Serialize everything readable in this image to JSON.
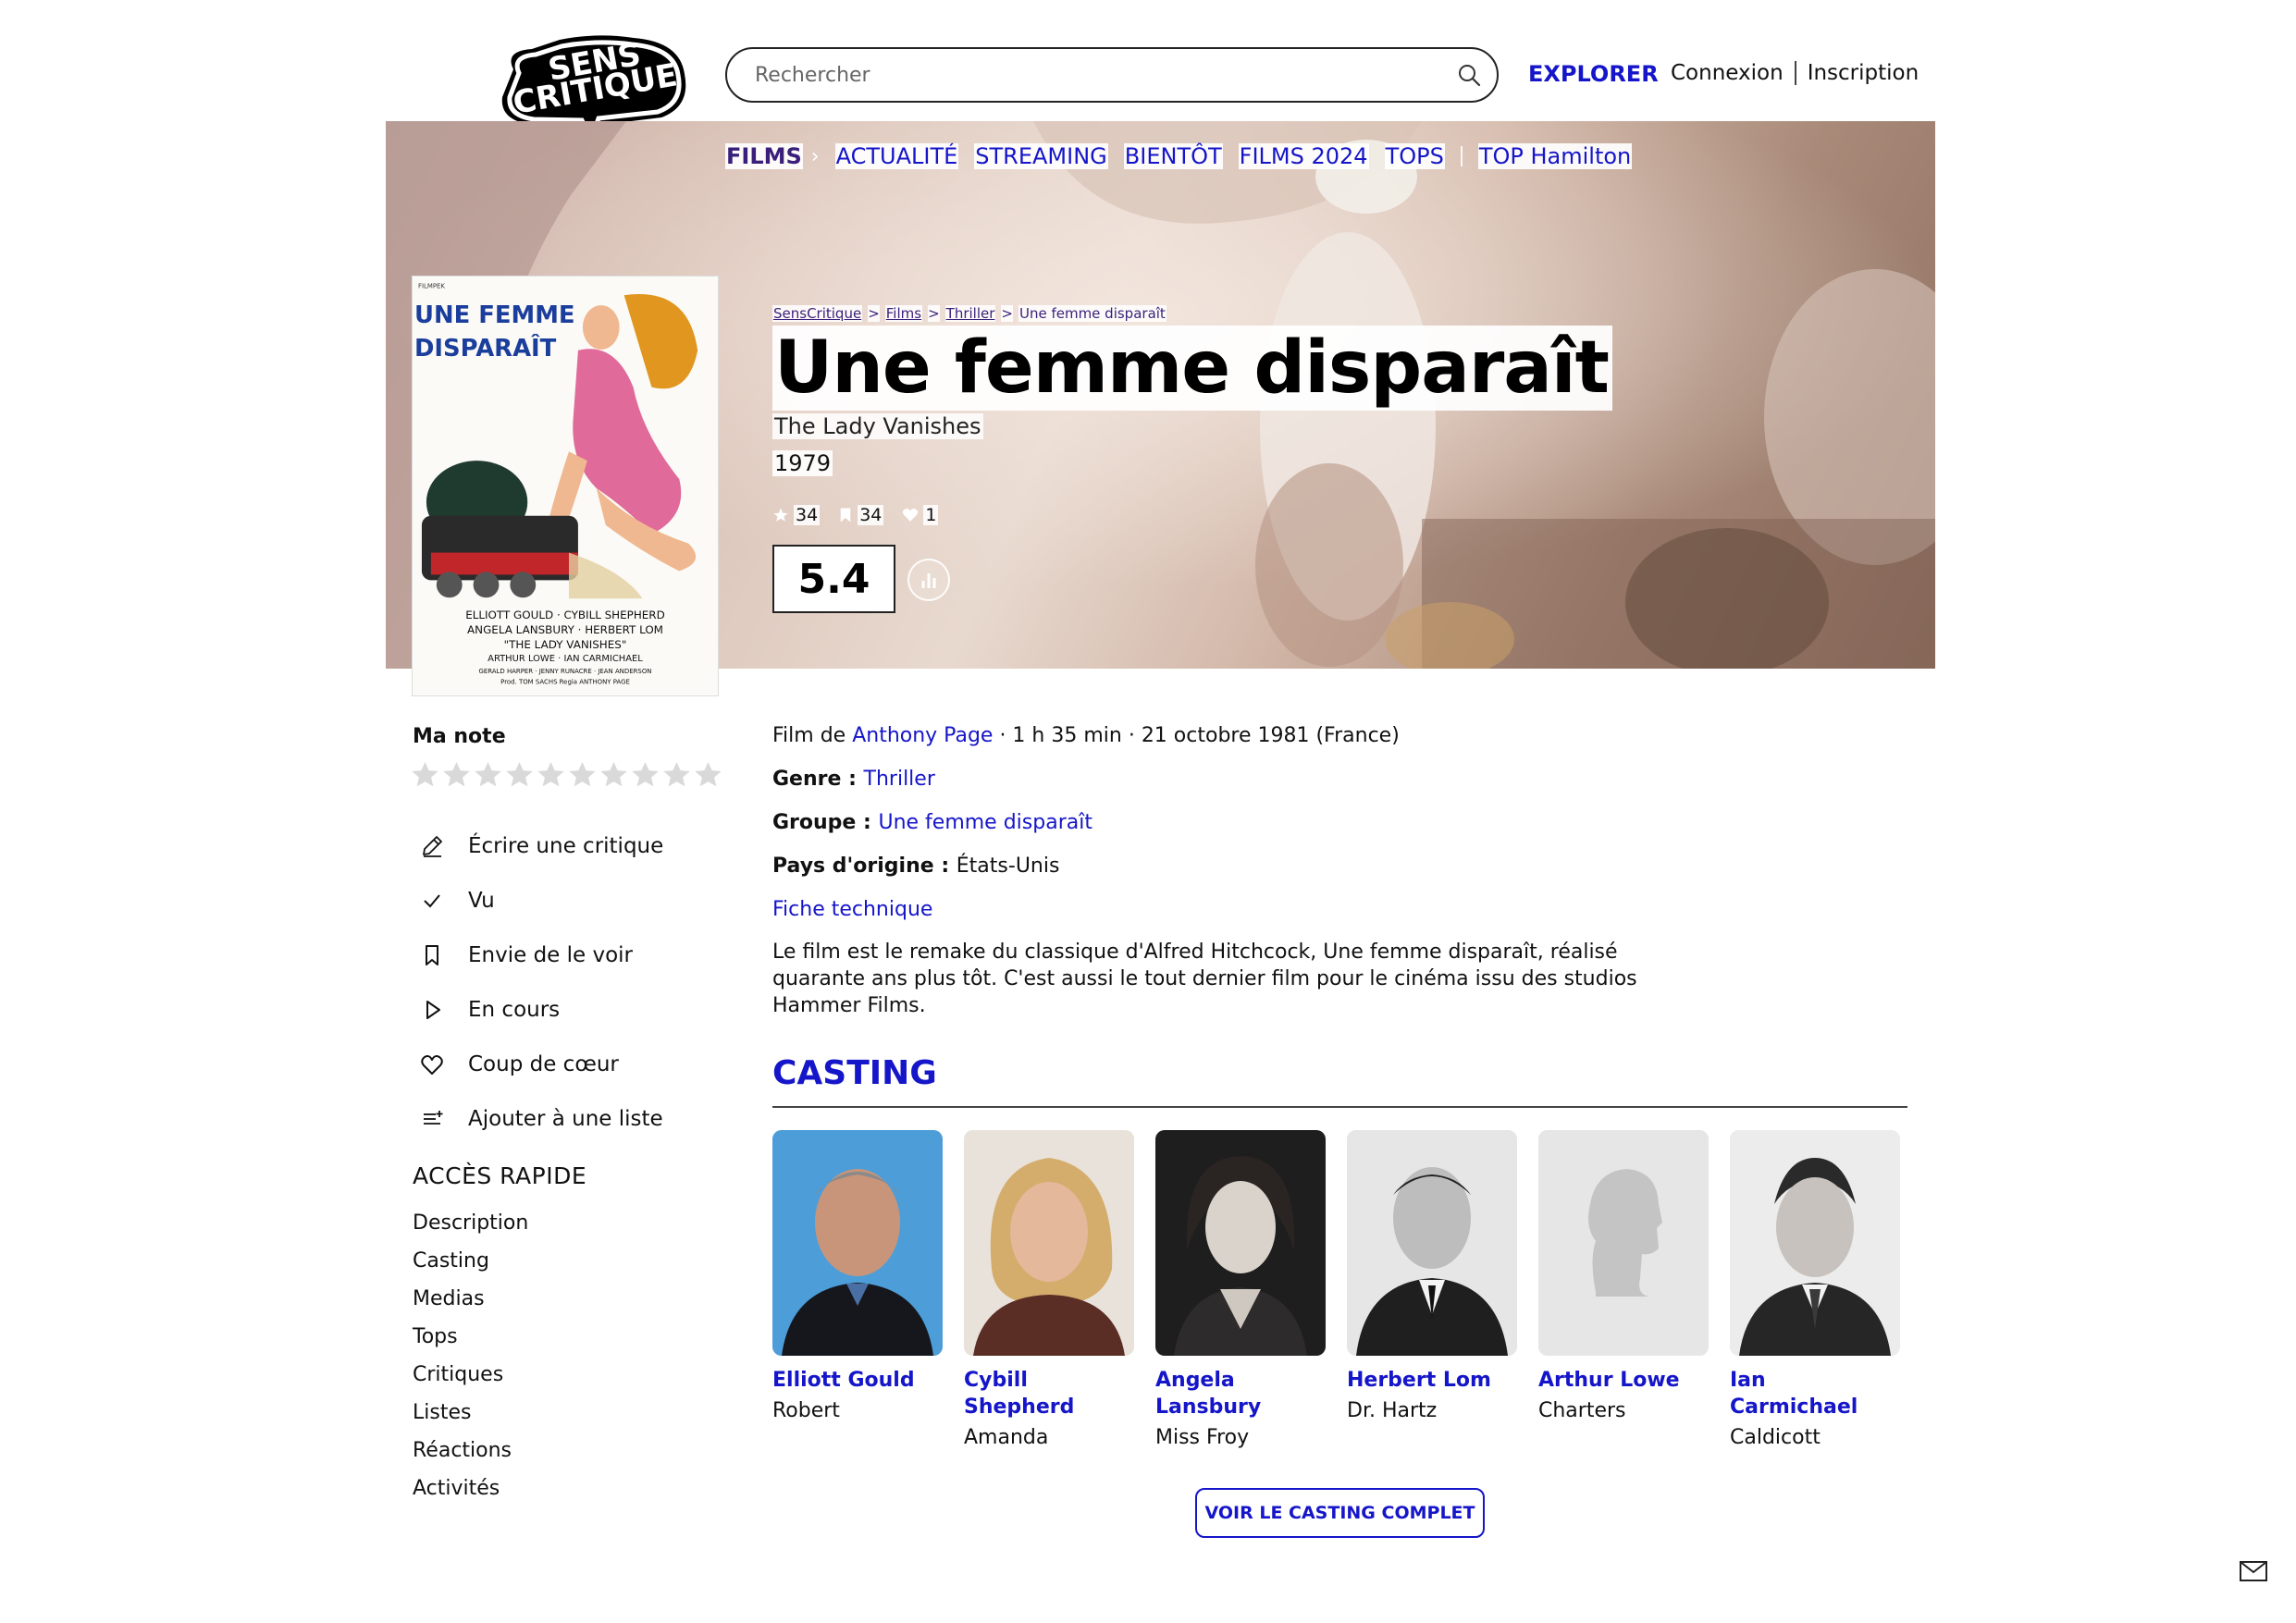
{
  "header": {
    "logo_text": [
      "SENS",
      "CRITIQUE"
    ],
    "search_placeholder": "Rechercher",
    "explorer": "EXPLORER",
    "login": "Connexion",
    "signup": "Inscription"
  },
  "subnav": {
    "items": [
      "FILMS",
      "ACTUALITÉ",
      "STREAMING",
      "BIENTÔT",
      "FILMS 2024",
      "TOPS",
      "TOP Hamilton"
    ],
    "current": "FILMS"
  },
  "breadcrumb": [
    "SensCritique",
    "Films",
    "Thriller",
    "Une femme disparaît"
  ],
  "film": {
    "title": "Une femme disparaît",
    "original_title": "The Lady Vanishes",
    "year": "1979",
    "stats": {
      "ratings": "34",
      "wishlist": "34",
      "favorites": "1"
    },
    "score": "5.4",
    "poster": {
      "title_lines": [
        "UNE FEMME",
        "DISPARAÎT"
      ],
      "credits": [
        "ELLIOTT GOULD · CYBILL SHEPHERD",
        "ANGELA LANSBURY · HERBERT LOM",
        "\"THE LADY VANISHES\"",
        "ARTHUR LOWE · IAN CARMICHAEL",
        "GERALD HARPER · JENNY RUNACRE · JEAN ANDERSON",
        "Prod. TOM SACHS    Regia ANTHONY PAGE"
      ],
      "brand": "FILMPEK"
    }
  },
  "sidebar": {
    "ma_note": "Ma note",
    "star_count": 10,
    "actions": [
      {
        "label": "Écrire une critique",
        "icon": "pencil-icon"
      },
      {
        "label": "Vu",
        "icon": "check-icon"
      },
      {
        "label": "Envie de le voir",
        "icon": "bookmark-icon"
      },
      {
        "label": "En cours",
        "icon": "play-icon"
      },
      {
        "label": "Coup de cœur",
        "icon": "heart-icon"
      },
      {
        "label": "Ajouter à une liste",
        "icon": "list-add-icon"
      }
    ],
    "quick_access_title": "ACCÈS RAPIDE",
    "quick_access": [
      "Description",
      "Casting",
      "Medias",
      "Tops",
      "Critiques",
      "Listes",
      "Réactions",
      "Activités"
    ]
  },
  "info": {
    "film_de": "Film de ",
    "director": "Anthony Page",
    "details": " · 1 h 35 min · 21 octobre 1981 (France)",
    "genre_label": "Genre : ",
    "genre": "Thriller",
    "groupe_label": "Groupe : ",
    "groupe": "Une femme disparaît",
    "pays_label": "Pays d'origine : ",
    "pays": "États-Unis",
    "fiche": "Fiche technique",
    "description": "Le film est le remake du classique d'Alfred Hitchcock, Une femme disparaît, réalisé quarante ans plus tôt. C'est aussi le tout dernier film pour le cinéma issu des studios Hammer Films."
  },
  "casting": {
    "title": "CASTING",
    "members": [
      {
        "name": "Elliott Gould",
        "role": "Robert"
      },
      {
        "name": "Cybill Shepherd",
        "role": "Amanda"
      },
      {
        "name": "Angela Lansbury",
        "role": "Miss Froy"
      },
      {
        "name": "Herbert Lom",
        "role": "Dr. Hartz"
      },
      {
        "name": "Arthur Lowe",
        "role": "Charters"
      },
      {
        "name": "Ian Carmichael",
        "role": "Caldicott"
      }
    ],
    "full_cast_button": "VOIR LE CASTING COMPLET"
  }
}
